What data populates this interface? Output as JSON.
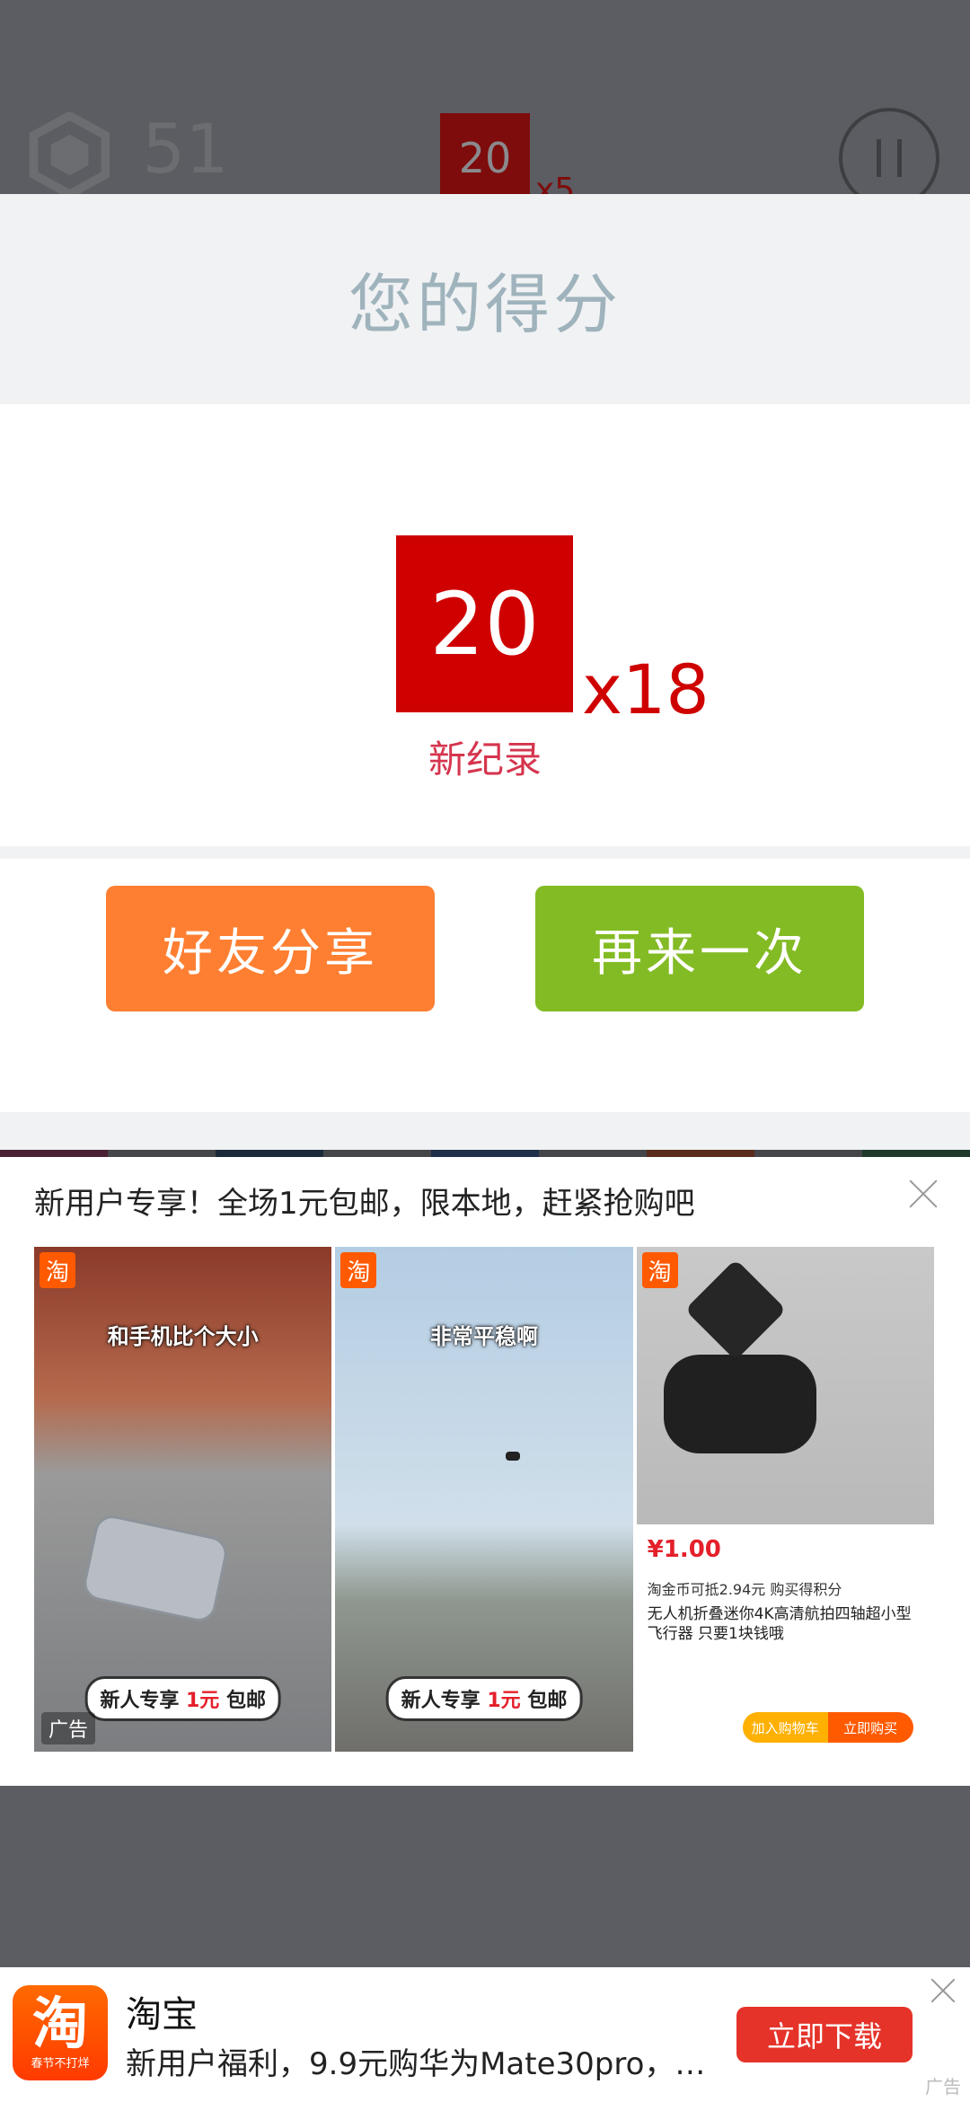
{
  "header": {
    "coins": "51",
    "current_tile": "20",
    "current_multiplier": "x5"
  },
  "modal": {
    "title": "您的得分",
    "score_tile": "20",
    "score_multiplier": "x18",
    "new_record": "新纪录",
    "share_button": "好友分享",
    "retry_button": "再来一次"
  },
  "colors": {
    "score_red": "#cf0000",
    "share_orange": "#fe7f32",
    "retry_green": "#83bb24",
    "title_gray": "#9fb3bc"
  },
  "ad": {
    "title": "新用户专享！全场1元包邮，限本地，赶紧抢购吧",
    "badge": "淘",
    "img1_caption": "和手机比个大小",
    "img2_caption": "非常平稳啊",
    "promo_prefix": "新人专享",
    "promo_price": "1元",
    "promo_suffix": "包邮",
    "price": "¥1.00",
    "product_line": "淘金币可抵2.94元  购买得积分",
    "product_title": "无人机折叠迷你4K高清航拍四轴超小型飞行器 只要1块钱哦",
    "cart_button": "加入购物车",
    "buy_button": "立即购买",
    "ad_label": "广告"
  },
  "banner": {
    "logo_char": "淘",
    "logo_slogan": "春节不打烊",
    "app_name": "淘宝",
    "description": "新用户福利，9.9元购华为Mate30pro，…",
    "download_button": "立即下载",
    "ad_label": "广告"
  }
}
